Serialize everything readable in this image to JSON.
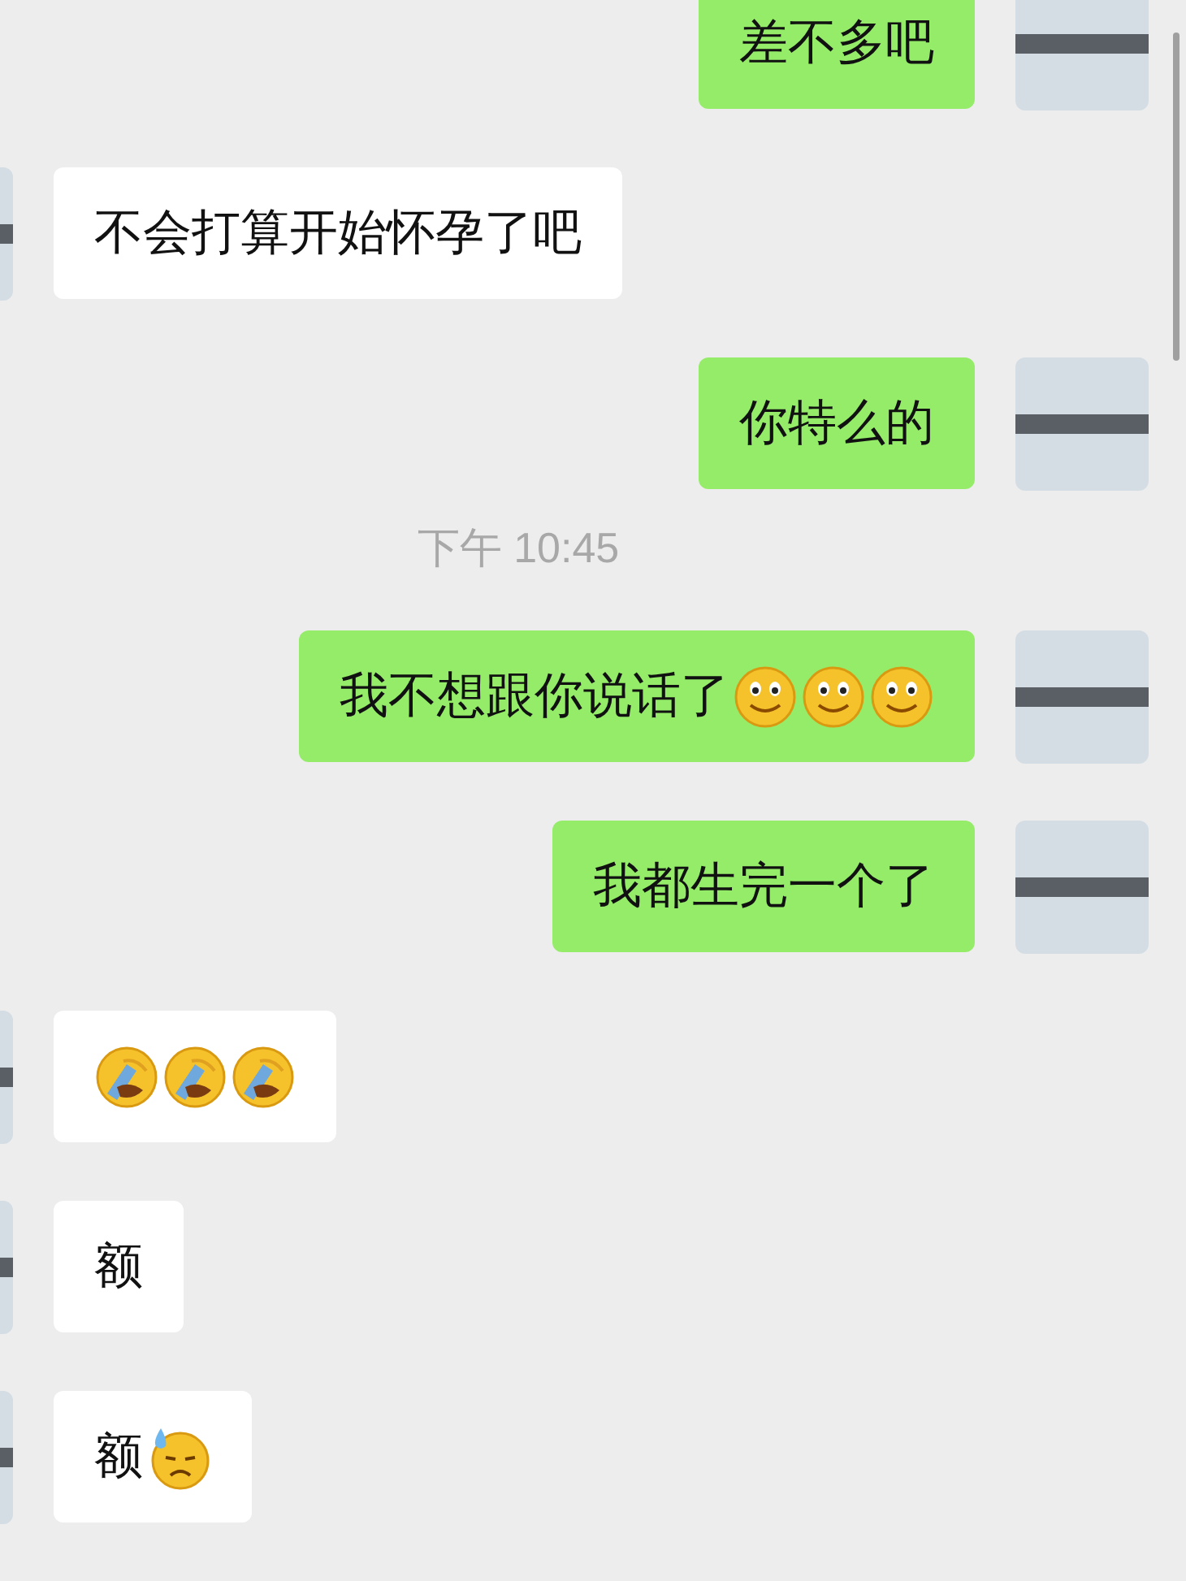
{
  "messages": [
    {
      "kind": "message",
      "outgoing": true,
      "text": "差不多吧"
    },
    {
      "kind": "message",
      "outgoing": false,
      "text": "不会打算开始怀孕了吧"
    },
    {
      "kind": "message",
      "outgoing": true,
      "text": "你特么的"
    },
    {
      "kind": "time",
      "text": "下午 10:45"
    },
    {
      "kind": "message",
      "outgoing": true,
      "text": "我不想跟你说话了",
      "emojis": [
        {
          "kind": "smile"
        },
        {
          "kind": "smile"
        },
        {
          "kind": "smile"
        }
      ]
    },
    {
      "kind": "message",
      "outgoing": true,
      "text": "我都生完一个了"
    },
    {
      "kind": "message",
      "outgoing": false,
      "emojis": [
        {
          "kind": "facepalm"
        },
        {
          "kind": "facepalm"
        },
        {
          "kind": "facepalm"
        }
      ]
    },
    {
      "kind": "message",
      "outgoing": false,
      "text": "额"
    },
    {
      "kind": "message",
      "outgoing": false,
      "text": "额",
      "emojis": [
        {
          "kind": "sweat"
        }
      ]
    }
  ]
}
